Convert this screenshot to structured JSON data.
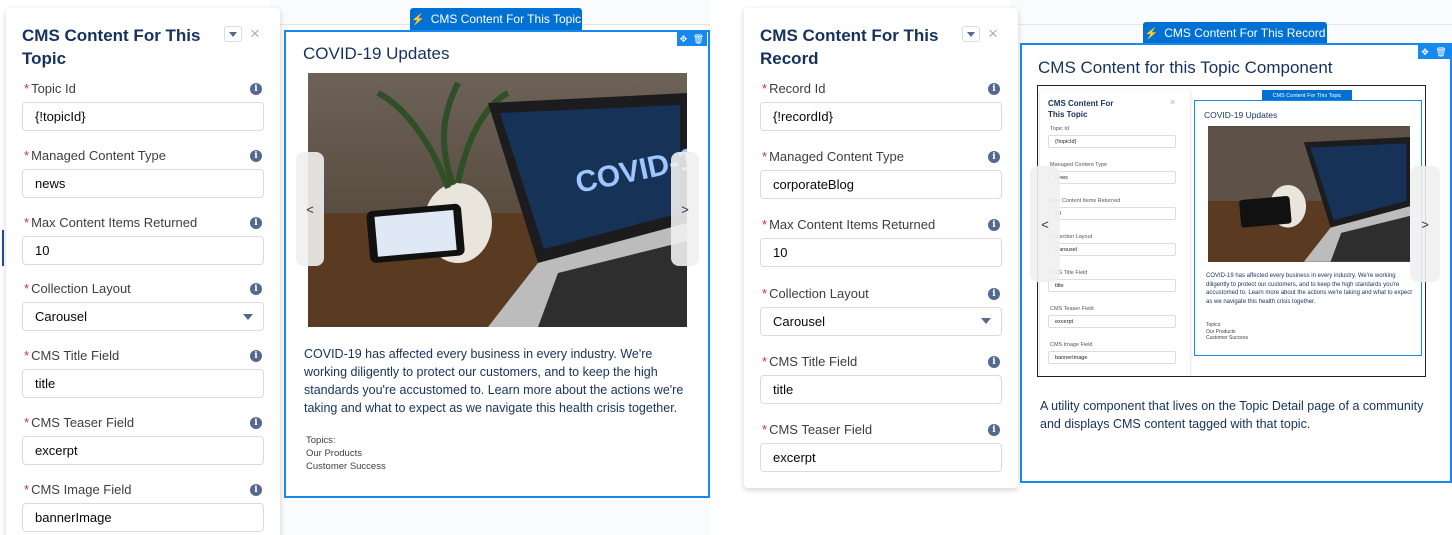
{
  "left": {
    "panel": {
      "title": "CMS Content For This Topic",
      "fields": [
        {
          "label": "Topic Id",
          "value": "{!topicId}",
          "type": "text"
        },
        {
          "label": "Managed Content Type",
          "value": "news",
          "type": "text"
        },
        {
          "label": "Max Content Items Returned",
          "value": "10",
          "type": "text"
        },
        {
          "label": "Collection Layout",
          "value": "Carousel",
          "type": "select"
        },
        {
          "label": "CMS Title Field",
          "value": "title",
          "type": "text"
        },
        {
          "label": "CMS Teaser Field",
          "value": "excerpt",
          "type": "text"
        },
        {
          "label": "CMS Image Field",
          "value": "bannerImage",
          "type": "text"
        }
      ]
    },
    "component": {
      "tab_label": "CMS Content For This Topic",
      "title": "COVID-19 Updates",
      "description": "COVID-19 has affected every business in every industry. We're working diligently to protect our customers, and to keep the high standards you're accustomed to. Learn more about the actions we're taking and what to expect as we navigate this health crisis together.",
      "topics_label": "Topics:",
      "topics": [
        "Our Products",
        "Customer Success"
      ],
      "prev": "<",
      "next": ">",
      "screen_text": "COVID-19"
    }
  },
  "right": {
    "panel": {
      "title": "CMS Content For This Record",
      "fields": [
        {
          "label": "Record Id",
          "value": "{!recordId}",
          "type": "text"
        },
        {
          "label": "Managed Content Type",
          "value": "corporateBlog",
          "type": "text"
        },
        {
          "label": "Max Content Items Returned",
          "value": "10",
          "type": "text"
        },
        {
          "label": "Collection Layout",
          "value": "Carousel",
          "type": "select"
        },
        {
          "label": "CMS Title Field",
          "value": "title",
          "type": "text"
        },
        {
          "label": "CMS Teaser Field",
          "value": "excerpt",
          "type": "text"
        }
      ]
    },
    "component": {
      "tab_label": "CMS Content For This Record",
      "title": "CMS Content for this Topic Component",
      "description": "A utility component that lives on the Topic Detail page of a community and displays CMS content tagged with that topic.",
      "prev": "<",
      "next": ">",
      "thumbnail": {
        "panel_title": "CMS Content For This Topic",
        "fields": [
          {
            "label": "Topic Id",
            "value": "{!topicId}"
          },
          {
            "label": "Managed Content Type",
            "value": "news"
          },
          {
            "label": "Max Content Items Returned",
            "value": "10"
          },
          {
            "label": "Collection Layout",
            "value": "Carousel"
          },
          {
            "label": "CMS Title Field",
            "value": "title"
          },
          {
            "label": "CMS Teaser Field",
            "value": "excerpt"
          },
          {
            "label": "CMS Image Field",
            "value": "bannerImage"
          }
        ],
        "tab_label": "CMS Content For This Topic",
        "comp_title": "COVID-19 Updates",
        "description": "COVID-19 has affected every business in every industry. We're working diligently to protect our customers, and to keep the high standards you're accustomed to. Learn more about the actions we're taking and what to expect as we navigate this health crisis together.",
        "topics_label": "Topics:",
        "topics": [
          "Our Products",
          "Customer Success"
        ]
      }
    }
  },
  "icons": {
    "info": "i",
    "close": "×",
    "bolt": "⚡",
    "move": "✥",
    "delete": "🗑"
  },
  "colors": {
    "brand": "#0070d2",
    "selection_border": "#1589ee",
    "required": "#c23934"
  }
}
